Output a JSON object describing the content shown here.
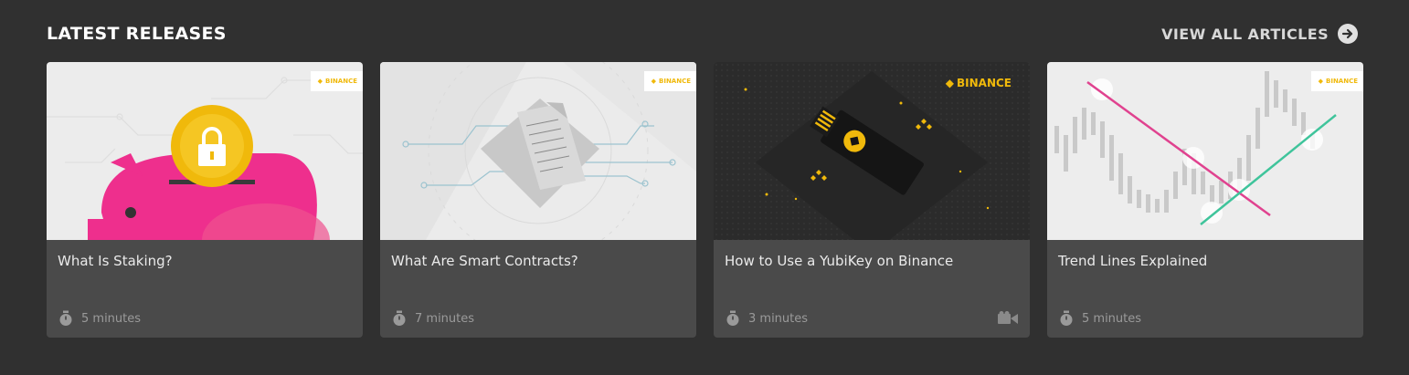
{
  "header": {
    "title": "LATEST RELEASES",
    "view_all_label": "VIEW ALL ARTICLES"
  },
  "brand": {
    "accent": "#f0b90b",
    "badge_text": "BINANCE"
  },
  "cards": [
    {
      "title": "What Is Staking?",
      "duration": "5 minutes",
      "thumbnail_icon": "piggy-bank-coin-lock",
      "video": false
    },
    {
      "title": "What Are Smart Contracts?",
      "duration": "7 minutes",
      "thumbnail_icon": "document-circuit",
      "video": false
    },
    {
      "title": "How to Use a YubiKey on Binance",
      "duration": "3 minutes",
      "thumbnail_icon": "usb-security-key",
      "video": true
    },
    {
      "title": "Trend Lines Explained",
      "duration": "5 minutes",
      "thumbnail_icon": "candlestick-trend-lines",
      "video": false
    }
  ]
}
